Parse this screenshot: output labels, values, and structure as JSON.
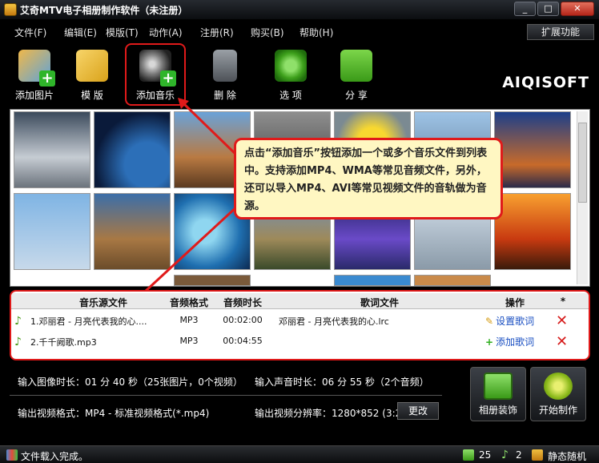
{
  "window": {
    "title": "艾奇MTV电子相册制作软件（未注册）",
    "controls": {
      "minimize": "_",
      "maximize": "□",
      "close": "✕"
    }
  },
  "menu": {
    "items": [
      "文件(F)",
      "编辑(E)",
      "模版(T)",
      "动作(A)",
      "注册(R)",
      "购买(B)",
      "帮助(H)"
    ],
    "extend_label": "扩展功能"
  },
  "toolbar": {
    "buttons": [
      {
        "label": "添加图片",
        "icon": "add-picture-icon"
      },
      {
        "label": "模 版",
        "icon": "template-icon"
      },
      {
        "label": "添加音乐",
        "icon": "add-music-icon"
      },
      {
        "label": "删 除",
        "icon": "trash-icon"
      },
      {
        "label": "选 项",
        "icon": "options-gear-icon"
      },
      {
        "label": "分 享",
        "icon": "share-icon"
      }
    ],
    "logo": "AIQISOFT"
  },
  "callout": {
    "text": "点击“添加音乐”按钮添加一个或多个音乐文件到列表中。支持添加MP4、WMA等常见音频文件，另外，还可以导入MP4、AVI等常见视频文件的音轨做为音源。"
  },
  "music_table": {
    "headers": [
      "音乐源文件",
      "音频格式",
      "音频时长",
      "歌词文件",
      "操作",
      "*"
    ],
    "rows": [
      {
        "file": "1.邓丽君 - 月亮代表我的心....",
        "format": "MP3",
        "duration": "00:02:00",
        "lyrics": "邓丽君 - 月亮代表我的心.lrc",
        "action": "设置歌词"
      },
      {
        "file": "2.千千阙歌.mp3",
        "format": "MP3",
        "duration": "00:04:55",
        "lyrics": "",
        "action": "添加歌词"
      }
    ]
  },
  "info": {
    "image_duration": "输入图像时长：01 分 40 秒（25张图片，0个视频）",
    "audio_duration": "输入声音时长：06 分 55 秒（2个音频）",
    "video_format": "输出视频格式：MP4 - 标准视频格式(*.mp4)",
    "resolution": "输出视频分辨率：1280*852 (3:2)",
    "change_label": "更改"
  },
  "actions": {
    "album_decor": "相册装饰",
    "start": "开始制作"
  },
  "status": {
    "message": "文件载入完成。",
    "image_count": "25",
    "audio_count": "2",
    "mode": "静态随机"
  }
}
